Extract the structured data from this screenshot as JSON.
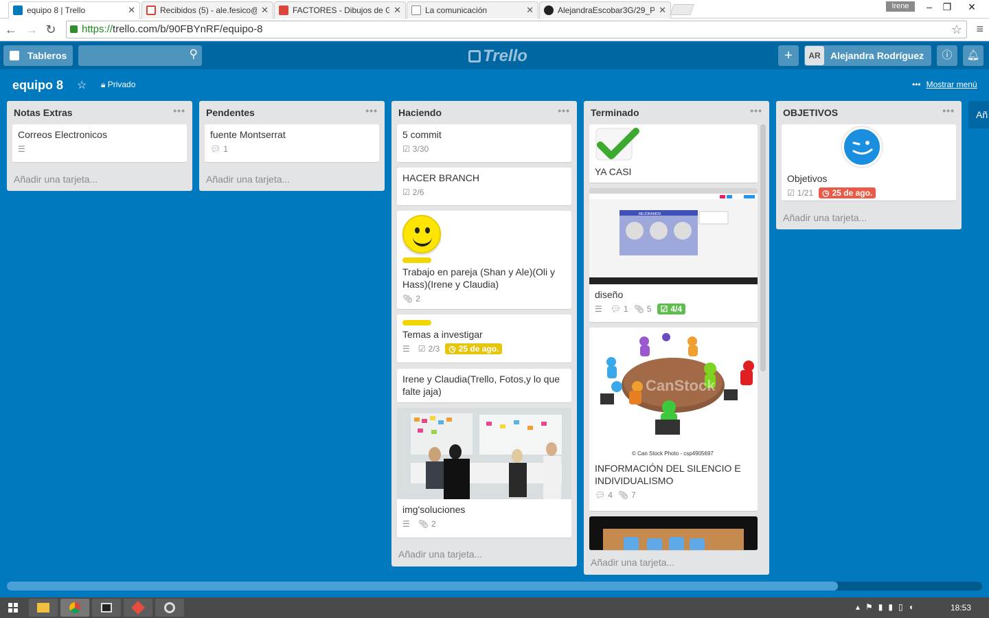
{
  "browser": {
    "tabs": [
      {
        "title": "equipo 8 | Trello",
        "active": true
      },
      {
        "title": "Recibidos (5) - ale.fesico@",
        "active": false
      },
      {
        "title": "FACTORES - Dibujos de G",
        "active": false
      },
      {
        "title": "La comunicación",
        "active": false
      },
      {
        "title": "AlejandraEscobar3G/29_P",
        "active": false
      }
    ],
    "user_badge": "Irene",
    "url_scheme": "https://",
    "url_rest": "trello.com/b/90FBYnRF/equipo-8"
  },
  "header": {
    "boards_label": "Tableros",
    "logo": "Trello",
    "member_initials": "AR",
    "member_name": "Alejandra Rodríguez"
  },
  "board": {
    "title": "equipo 8",
    "visibility": "Privado",
    "show_menu": "Mostrar menú",
    "add_list_partial": "Añ"
  },
  "add_card_label": "Añadir una tarjeta...",
  "lists": [
    {
      "name": "Notas Extras",
      "cards": [
        {
          "title": "Correos Electronicos",
          "badges": {
            "description": true
          }
        }
      ]
    },
    {
      "name": "Pendentes",
      "cards": [
        {
          "title": "fuente Montserrat",
          "badges": {
            "comments": "1"
          }
        }
      ]
    },
    {
      "name": "Haciendo",
      "cards": [
        {
          "title": "5 commit",
          "badges": {
            "checklist": "3/30"
          }
        },
        {
          "title": "HACER BRANCH",
          "badges": {
            "checklist": "2/6"
          }
        },
        {
          "title": "Trabajo en pareja (Shan y Ale)(Oli y Hass)(Irene y Claudia)",
          "badges": {
            "attachments": "2"
          }
        },
        {
          "title": "Temas a investigar",
          "badges": {
            "checklist": "2/3",
            "due": "25 de ago."
          }
        },
        {
          "title": "Irene y Claudia(Trello, Fotos,y lo que falte jaja)"
        },
        {
          "title": "img'soluciones",
          "badges": {
            "attachments": "2"
          }
        }
      ]
    },
    {
      "name": "Terminado",
      "cards": [
        {
          "title": "YA CASI"
        },
        {
          "title": "diseño",
          "badges": {
            "comments": "1",
            "attachments": "5",
            "checklist": "4/4"
          }
        },
        {
          "title": "INFORMACIÓN DEL SILENCIO E INDIVIDUALISMO",
          "badges": {
            "comments": "4",
            "attachments": "7"
          },
          "image_caption": "© Can Stock Photo - csp4905697",
          "watermark": "CanStock"
        }
      ]
    },
    {
      "name": "OBJETIVOS",
      "cards": [
        {
          "title": "Objetivos",
          "badges": {
            "checklist": "1/21",
            "due": "25 de ago."
          }
        }
      ]
    }
  ],
  "screenshot_text": {
    "mejoramos": "MEJORAMOS"
  },
  "taskbar": {
    "clock": "18:53"
  },
  "colors": {
    "board_bg": "#0079bf",
    "header_bg": "#0067a3",
    "label_yellow": "#f2d600",
    "due_red": "#eb5a46",
    "due_yellow": "#e6c60d",
    "done_green": "#61bd4f"
  }
}
